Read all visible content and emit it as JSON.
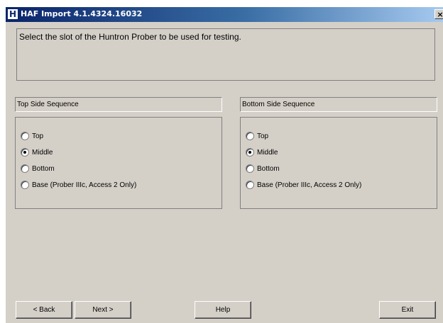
{
  "window": {
    "title": "HAF Import 4.1.4324.16032",
    "icon_letter": "H",
    "close_glyph": "×"
  },
  "instruction": "Select the slot of the Huntron Prober to be used for testing.",
  "top_side": {
    "label": "Top Side Sequence",
    "options": [
      "Top",
      "Middle",
      "Bottom",
      "Base (Prober IIIc, Access 2 Only)"
    ],
    "selected": "Middle"
  },
  "bottom_side": {
    "label": "Bottom Side Sequence",
    "options": [
      "Top",
      "Middle",
      "Bottom",
      "Base (Prober IIIc, Access 2 Only)"
    ],
    "selected": "Middle"
  },
  "buttons": {
    "back": "< Back",
    "next": "Next >",
    "help": "Help",
    "exit": "Exit"
  }
}
